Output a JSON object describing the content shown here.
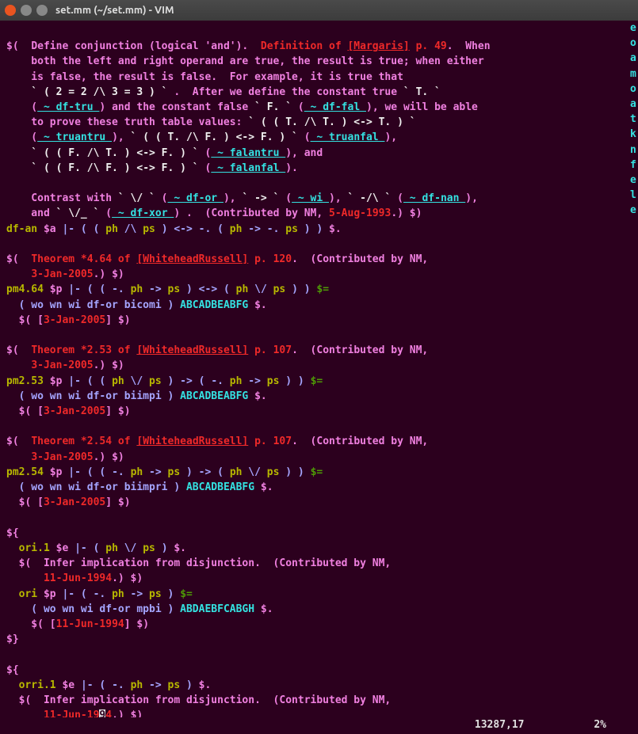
{
  "window": {
    "title": "set.mm (~/set.mm) - VIM"
  },
  "status": {
    "pos": "13287,17",
    "pct": "2%"
  },
  "side": "e\n\n\no\na\nm\no\na\nt\nk\nn\nf\ne\nl\ne",
  "t": {
    "l1a": "$(  ",
    "l1b": "Define conjunction (logical 'and').  ",
    "l1c": "Definition of ",
    "l1d": "[Margaris]",
    "l1e": " p. 49",
    "l1f": ".  When",
    "l2": "    both the left and right operand are true, the result is true; when either",
    "l3": "    is false, the result is false.  For example, it is true that",
    "l4a": "    ",
    "l4b": "` ( 2 = 2 /\\ 3 = 3 ) `",
    "l4c": " .  After we define the constant true ",
    "l4d": "` T. `",
    "l5a": "    (",
    "l5b": " ~ df-tru ",
    "l5c": ") and the constant false ",
    "l5d": "` F. `",
    "l5e": " (",
    "l5f": " ~ df-fal ",
    "l5g": "), we will be able",
    "l6a": "    to prove these truth table values: ",
    "l6b": "` ( ( T. /\\ T. ) <-> T. ) `",
    "l7a": "    (",
    "l7b": " ~ truantru ",
    "l7c": "), ",
    "l7d": "` ( ( T. /\\ F. ) <-> F. ) `",
    "l7e": " (",
    "l7f": " ~ truanfal ",
    "l7g": "),",
    "l8a": "    ",
    "l8b": "` ( ( F. /\\ T. ) <-> F. ) `",
    "l8c": " (",
    "l8d": " ~ falantru ",
    "l8e": "), and",
    "l9a": "    ",
    "l9b": "` ( ( F. /\\ F. ) <-> F. ) `",
    "l9c": " (",
    "l9d": " ~ falanfal ",
    "l9e": ").",
    "l11a": "    Contrast with ",
    "l11b": "` \\/ `",
    "l11c": " (",
    "l11d": " ~ df-or ",
    "l11e": "), ",
    "l11f": "` -> `",
    "l11g": " (",
    "l11h": " ~ wi ",
    "l11i": "), ",
    "l11j": "` -/\\ `",
    "l11k": " (",
    "l11l": " ~ df-nan ",
    "l11m": "),",
    "l12a": "    and ",
    "l12b": "` \\/_ `",
    "l12c": " (",
    "l12d": " ~ df-xor ",
    "l12e": ") .  (Contributed by NM, ",
    "l12f": "5-Aug-1993",
    "l12g": ".) ",
    "l12h": "$)",
    "l13a": "df-an ",
    "l13b": "$a ",
    "l13c": "|- ( ( ",
    "l13d": "ph",
    "l13e": " /\\ ",
    "l13f": "ps",
    "l13g": " ) <-> -. ( ",
    "l13h": "ph",
    "l13i": " -> -. ",
    "l13j": "ps",
    "l13k": " ) ) ",
    "l13l": "$.",
    "l15a": "$(  ",
    "l15b": "Theorem *4.64 of ",
    "l15c": "[WhiteheadRussell]",
    "l15d": " p. 120",
    "l15e": ".  (Contributed by NM,",
    "l16a": "    ",
    "l16b": "3-Jan-2005",
    "l16c": ".) ",
    "l16d": "$)",
    "l17a": "pm4.64 ",
    "l17b": "$p ",
    "l17c": "|- ( ( -. ",
    "l17d": "ph",
    "l17e": " -> ",
    "l17f": "ps",
    "l17g": " ) <-> ( ",
    "l17h": "ph",
    "l17i": " \\/ ",
    "l17j": "ps",
    "l17k": " ) ) ",
    "l17l": "$=",
    "l18a": "  ( wo wn wi df-or bicomi ) ",
    "l18b": "ABCADBEABFG ",
    "l18c": "$.",
    "l19a": "  $( ",
    "l19b": "[",
    "l19c": "3-Jan-2005",
    "l19d": "]",
    "l19e": " $)",
    "l21a": "$(  ",
    "l21b": "Theorem *2.53 of ",
    "l21c": "[WhiteheadRussell]",
    "l21d": " p. 107",
    "l21e": ".  (Contributed by NM,",
    "l23a": "pm2.53 ",
    "l23b": "$p ",
    "l23c": "|- ( ( ",
    "l23d": "ph",
    "l23e": " \\/ ",
    "l23f": "ps",
    "l23g": " ) -> ( -. ",
    "l23h": "ph",
    "l23i": " -> ",
    "l23j": "ps",
    "l23k": " ) ) ",
    "l23l": "$=",
    "l24a": "  ( wo wn wi df-or biimpi ) ",
    "l24b": "ABCADBEABFG ",
    "l24c": "$.",
    "l27a": "$(  ",
    "l27b": "Theorem *2.54 of ",
    "l27c": "[WhiteheadRussell]",
    "l27d": " p. 107",
    "l27e": ".  (Contributed by NM,",
    "l29a": "pm2.54 ",
    "l29b": "$p ",
    "l29c": "|- ( ( -. ",
    "l29d": "ph",
    "l29e": " -> ",
    "l29f": "ps",
    "l29g": " ) -> ( ",
    "l29h": "ph",
    "l29i": " \\/ ",
    "l29j": "ps",
    "l29k": " ) ) ",
    "l29l": "$=",
    "l30a": "  ( wo wn wi df-or biimpri ) ",
    "l30b": "ABCADBEABFG ",
    "l30c": "$.",
    "l33a": "${",
    "l34a": "  ori.1 ",
    "l34b": "$e ",
    "l34c": "|- ( ",
    "l34d": "ph",
    "l34e": " \\/ ",
    "l34f": "ps",
    "l34g": " ) ",
    "l34h": "$.",
    "l35a": "  $(  ",
    "l35b": "Infer implication from disjunction.  (Contributed by NM,",
    "l36a": "      ",
    "l36b": "11-Jun-1994",
    "l36c": ".) ",
    "l36d": "$)",
    "l37a": "  ori ",
    "l37b": "$p ",
    "l37c": "|- ( -. ",
    "l37d": "ph",
    "l37e": " -> ",
    "l37f": "ps",
    "l37g": " ) ",
    "l37h": "$=",
    "l38a": "    ( wo wn wi df-or mpbi ) ",
    "l38b": "ABDAEBFCABGH ",
    "l38c": "$.",
    "l39a": "    $( ",
    "l39b": "[",
    "l39c": "11-Jun-1994",
    "l39d": "]",
    "l39e": " $)",
    "l40a": "$}",
    "l43a": "  orri.1 ",
    "l43b": "$e ",
    "l43c": "|- ( -. ",
    "l43d": "ph",
    "l43e": " -> ",
    "l43f": "ps",
    "l43g": " ) ",
    "l43h": "$.",
    "l45a": "      ",
    "l45b": "11-Jun-19",
    "l45c": "9",
    "l45d": "4",
    "l45e": ".) ",
    "l45f": "$)"
  }
}
